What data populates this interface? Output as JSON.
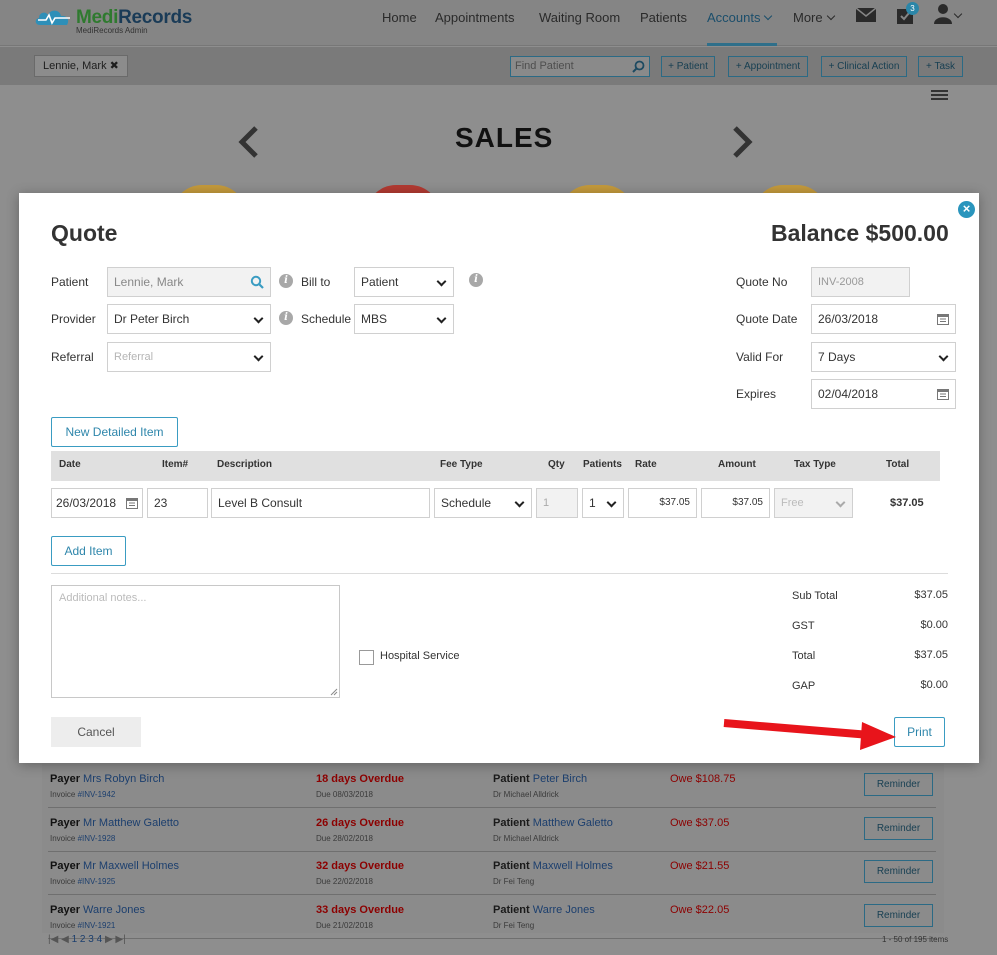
{
  "app": {
    "brand_medi": "Medi",
    "brand_records": "Records",
    "subtitle": "MediRecords Admin"
  },
  "nav": {
    "items": [
      "Home",
      "Appointments",
      "Waiting Room",
      "Patients",
      "Accounts",
      "More"
    ],
    "active": "Accounts",
    "task_badge": "3"
  },
  "subbar": {
    "patient_chip": "Lennie, Mark",
    "find_placeholder": "Find Patient",
    "buttons": [
      "+ Patient",
      "+ Appointment",
      "+ Clinical Action",
      "+ Task"
    ]
  },
  "dashboard": {
    "title": "SALES",
    "blob_colors": [
      "#c49a3c",
      "#b23a32",
      "#c49a3c",
      "#c49a3c"
    ]
  },
  "quote": {
    "title": "Quote",
    "balance": "Balance $500.00",
    "labels": {
      "patient": "Patient",
      "provider": "Provider",
      "referral": "Referral",
      "bill_to": "Bill to",
      "schedule": "Schedule",
      "quote_no": "Quote No",
      "quote_date": "Quote Date",
      "valid_for": "Valid For",
      "expires": "Expires"
    },
    "values": {
      "patient": "Lennie, Mark",
      "provider": "Dr Peter Birch",
      "referral_placeholder": "Referral",
      "bill_to": "Patient",
      "schedule": "MBS",
      "quote_no": "INV-2008",
      "quote_date": "26/03/2018",
      "valid_for": "7 Days",
      "expires": "02/04/2018"
    },
    "new_detailed_item": "New Detailed Item",
    "columns": [
      "Date",
      "Item#",
      "Description",
      "Fee Type",
      "Qty",
      "Patients",
      "Rate",
      "Amount",
      "Tax Type",
      "Total"
    ],
    "row": {
      "date": "26/03/2018",
      "item": "23",
      "description": "Level B Consult",
      "fee_type": "Schedule",
      "qty": "1",
      "patients": "1",
      "rate": "$37.05",
      "amount": "$37.05",
      "tax_type": "Free",
      "total": "$37.05"
    },
    "add_item": "Add Item",
    "notes_placeholder": "Additional notes...",
    "hospital_service": "Hospital Service",
    "summary": [
      {
        "label": "Sub Total",
        "value": "$37.05"
      },
      {
        "label": "GST",
        "value": "$0.00"
      },
      {
        "label": "Total",
        "value": "$37.05"
      },
      {
        "label": "GAP",
        "value": "$0.00"
      }
    ],
    "cancel": "Cancel",
    "print": "Print"
  },
  "overdue": {
    "payer_label": "Payer",
    "patient_label": "Patient",
    "reminder_label": "Reminder",
    "rows": [
      {
        "payer": "Mrs Robyn Birch",
        "invoice_prefix": "Invoice ",
        "invoice": "#INV-1942",
        "overdue": "18 days Overdue",
        "due": "Due 08/03/2018",
        "patient": "Peter Birch",
        "doctor": "Dr Michael Alldrick",
        "owe": "Owe $108.75"
      },
      {
        "payer": "Mr Matthew Galetto",
        "invoice_prefix": "Invoice ",
        "invoice": "#INV-1928",
        "overdue": "26 days Overdue",
        "due": "Due 28/02/2018",
        "patient": "Matthew Galetto",
        "doctor": "Dr Michael Alldrick",
        "owe": "Owe $37.05"
      },
      {
        "payer": "Mr Maxwell Holmes",
        "invoice_prefix": "Invoice ",
        "invoice": "#INV-1925",
        "overdue": "32 days Overdue",
        "due": "Due 22/02/2018",
        "patient": "Maxwell Holmes",
        "doctor": "Dr Fei Teng",
        "owe": "Owe $21.55"
      },
      {
        "payer": "Warre Jones",
        "invoice_prefix": "Invoice ",
        "invoice": "#INV-1921",
        "overdue": "33 days Overdue",
        "due": "Due 21/02/2018",
        "patient": "Warre Jones",
        "doctor": "Dr Fei Teng",
        "owe": "Owe $22.05"
      }
    ],
    "pages": [
      "1",
      "2",
      "3",
      "4"
    ],
    "pager_info": "1 - 50 of 195 items"
  },
  "annotation": {
    "arrow_color": "#e8141b"
  }
}
